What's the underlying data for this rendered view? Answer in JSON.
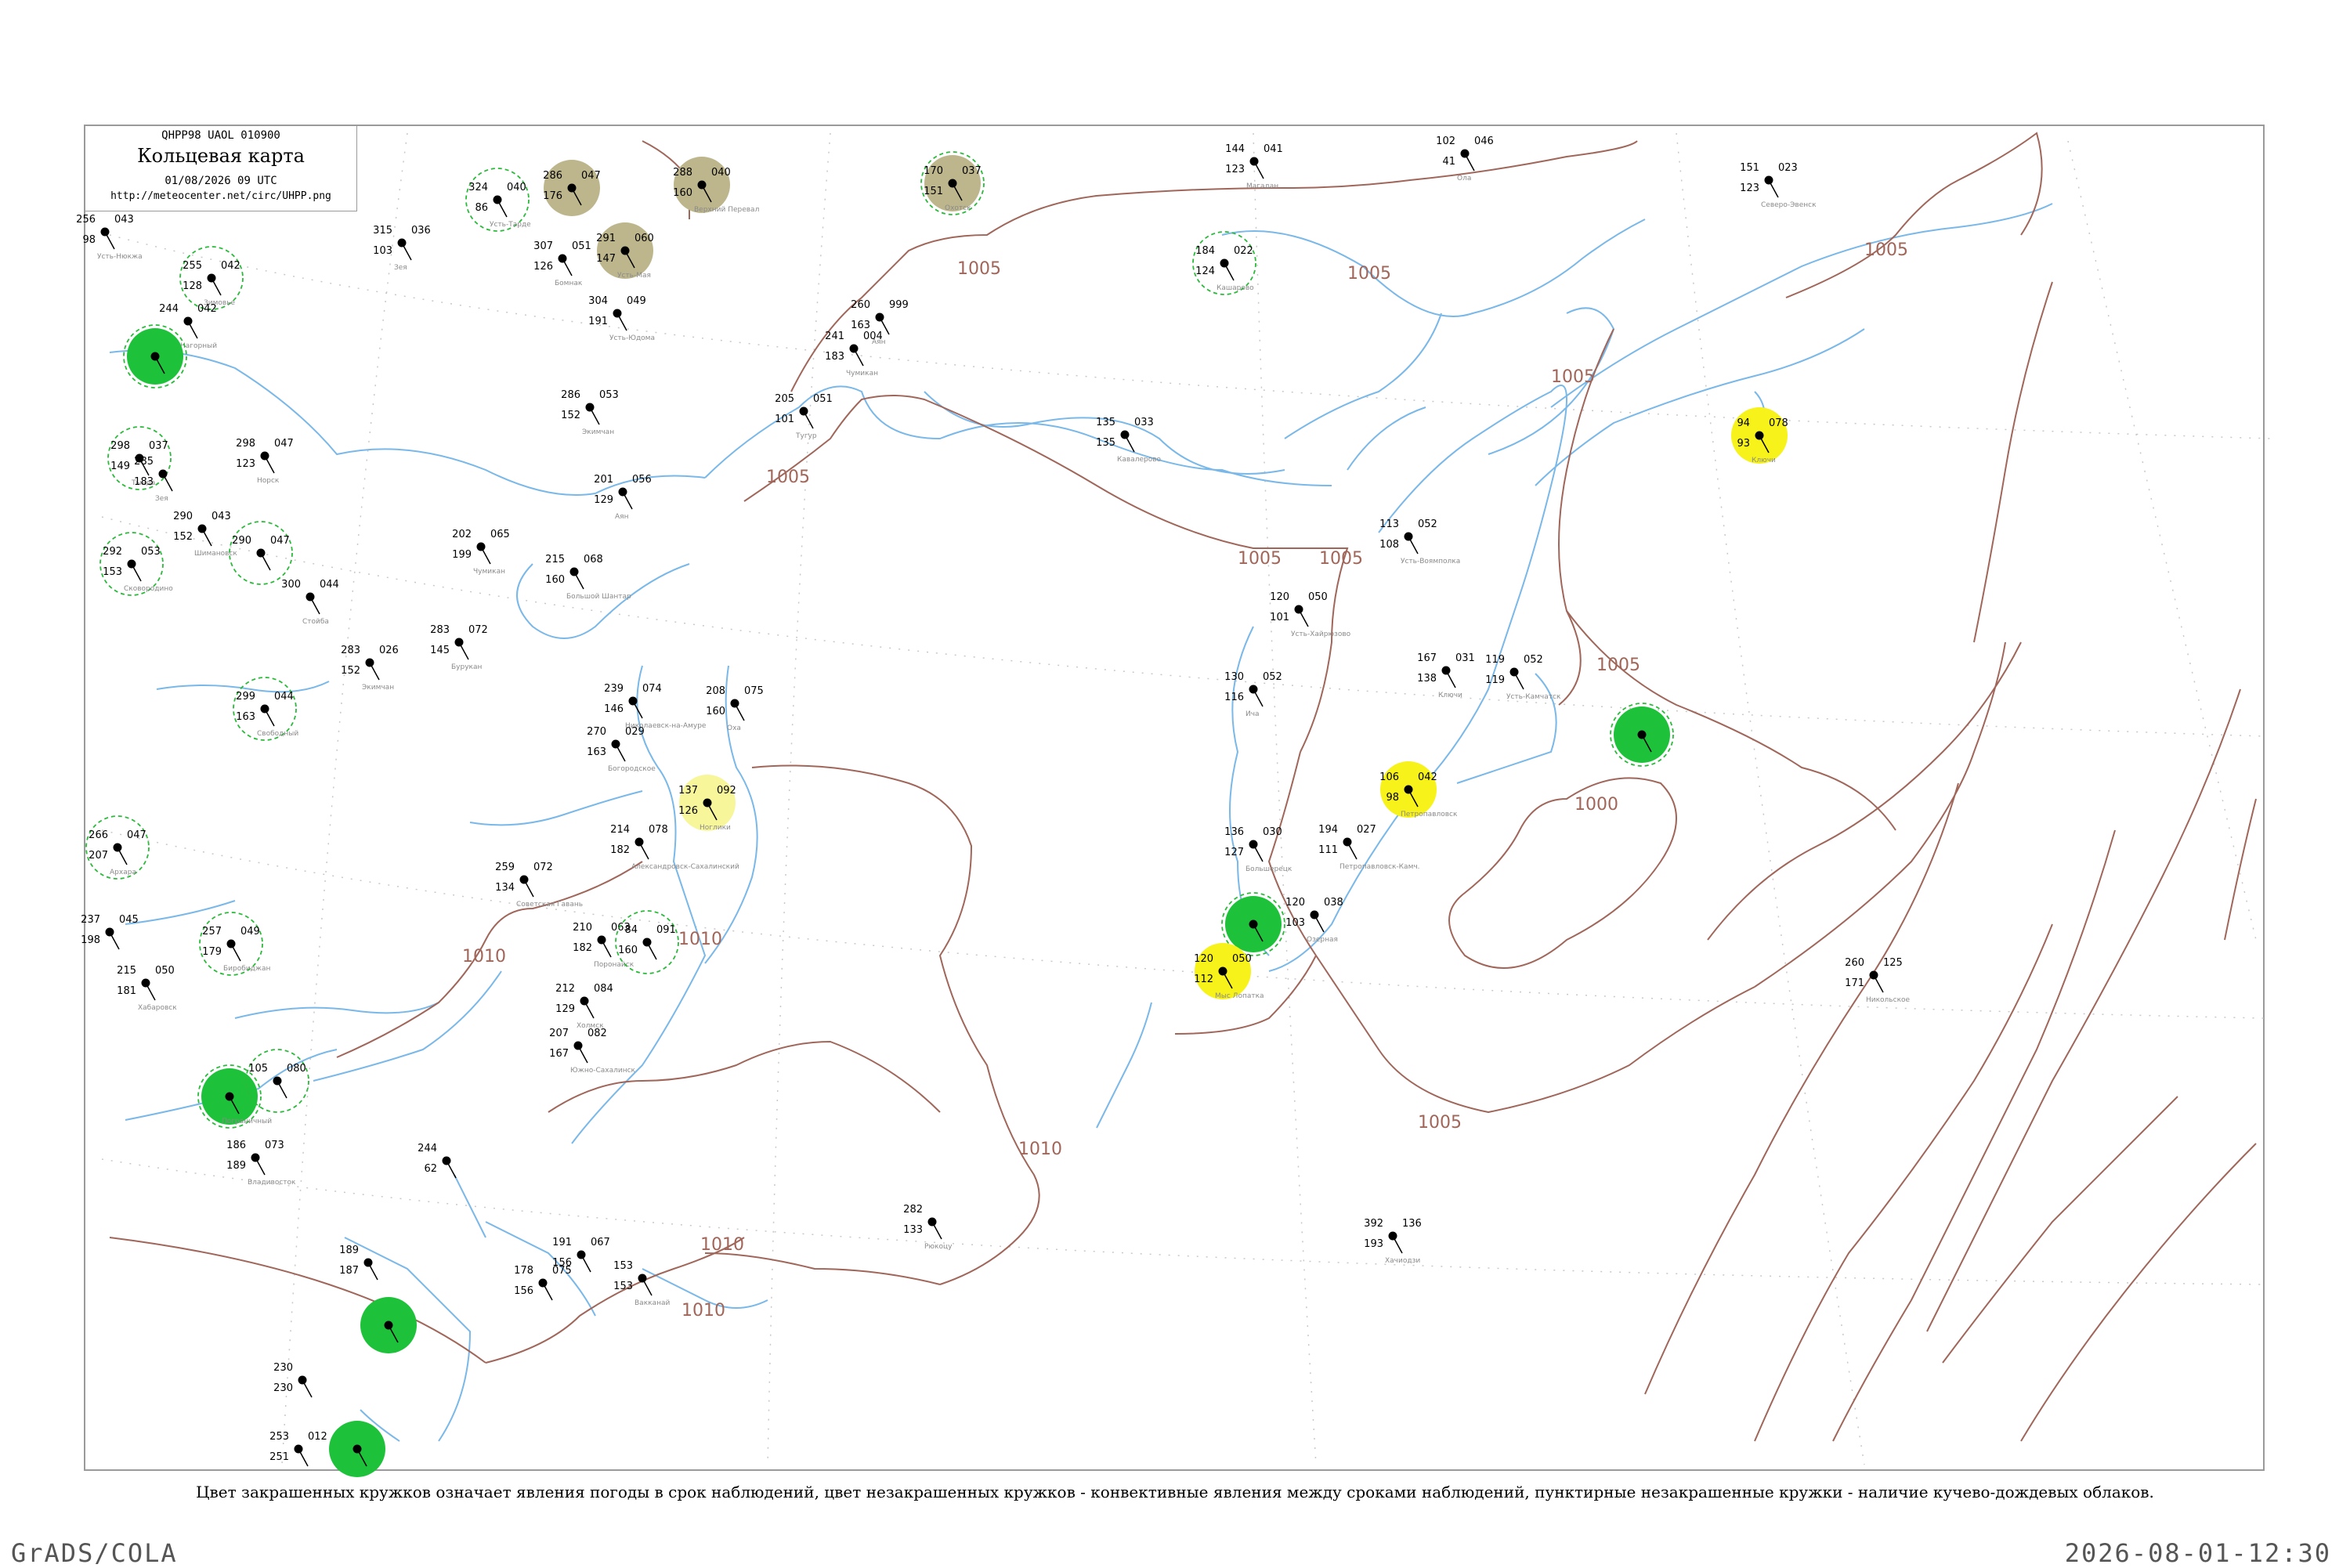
{
  "header": {
    "code": "QHPP98  UAOL  010900",
    "title": "Кольцевая карта",
    "datetime": "01/08/2026 09 UTC",
    "url": "http://meteocenter.net/circ/UHPP.png"
  },
  "caption": "Цвет закрашенных кружков означает явления погоды в срок наблюдений, цвет незакрашенных кружков - конвективные явления между сроками наблюдений, пунктирные незакрашенные кружки - наличие кучево-дождевых облаков.",
  "footer": {
    "left": "GrADS/COLA",
    "right": "2026-08-01-12:30"
  },
  "colors": {
    "coast": "#79b8e8",
    "isobar": "#a0665a",
    "green_fill": "#1ec23a",
    "yellow_fill": "#f6f21a",
    "light_yellow_fill": "#f8f69a",
    "olive_fill": "#bdb68c",
    "dashed_green": "#2aba3a"
  },
  "isobars": [
    {
      "label": "1005"
    },
    {
      "label": "1005"
    },
    {
      "label": "1005"
    },
    {
      "label": "1005"
    },
    {
      "label": "1005"
    },
    {
      "label": "1005"
    },
    {
      "label": "1005"
    },
    {
      "label": "1005"
    },
    {
      "label": "1005"
    },
    {
      "label": "1010"
    },
    {
      "label": "1010"
    },
    {
      "label": "1010"
    },
    {
      "label": "1010"
    },
    {
      "label": "1010"
    },
    {
      "label": "1000"
    }
  ],
  "stations": [
    {
      "t": "256",
      "m": "043",
      "b": "98",
      "name": "Усть-Нюкжа"
    },
    {
      "t": "255",
      "m": "042",
      "b": "128",
      "name": "Зимовье",
      "ring": "dashed"
    },
    {
      "t": "244",
      "m": "042",
      "b": "",
      "name": "Нагорный"
    },
    {
      "t": "",
      "m": "",
      "b": "",
      "name": "",
      "fill": "green",
      "ring": "dashed"
    },
    {
      "t": "324",
      "m": "040",
      "b": "86",
      "name": "Усть-Тарде",
      "ring": "dashed"
    },
    {
      "t": "286",
      "m": "047",
      "b": "176",
      "name": "",
      "fill": "olive"
    },
    {
      "t": "288",
      "m": "040",
      "b": "160",
      "name": "Верхний Перевал",
      "fill": "olive"
    },
    {
      "t": "170",
      "m": "037",
      "b": "151",
      "name": "Охотск",
      "fill": "olive",
      "ring": "dashed"
    },
    {
      "t": "315",
      "m": "036",
      "b": "103",
      "name": "Зея"
    },
    {
      "t": "307",
      "m": "051",
      "b": "126",
      "name": "Бомнак"
    },
    {
      "t": "291",
      "m": "060",
      "b": "147",
      "name": "Усть-Мая",
      "fill": "olive"
    },
    {
      "t": "184",
      "m": "022",
      "b": "124",
      "name": "Кашарово",
      "ring": "dashed"
    },
    {
      "t": "144",
      "m": "041",
      "b": "123",
      "name": "Магадан"
    },
    {
      "t": "102",
      "m": "046",
      "b": "41",
      "name": "Ола"
    },
    {
      "t": "151",
      "m": "023",
      "b": "123",
      "name": "Северо-Эвенск"
    },
    {
      "t": "304",
      "m": "049",
      "b": "191",
      "name": "Усть-Юдома"
    },
    {
      "t": "260",
      "m": "999",
      "b": "163",
      "name": "Аян"
    },
    {
      "t": "241",
      "m": "004",
      "b": "183",
      "name": "Чумикан"
    },
    {
      "t": "286",
      "m": "053",
      "b": "152",
      "name": "Экимчан"
    },
    {
      "t": "205",
      "m": "051",
      "b": "101",
      "name": "Тугур"
    },
    {
      "t": "135",
      "m": "033",
      "b": "135",
      "name": "Кавалерово"
    },
    {
      "t": "94",
      "m": "078",
      "b": "93",
      "name": "Ключи",
      "fill": "yellow"
    },
    {
      "t": "298",
      "m": "037",
      "b": "149",
      "name": "Тында",
      "ring": "dashed"
    },
    {
      "t": "298",
      "m": "047",
      "b": "123",
      "name": "Норск"
    },
    {
      "t": "285",
      "m": "",
      "b": "183",
      "name": "Зея"
    },
    {
      "t": "201",
      "m": "056",
      "b": "129",
      "name": "Аян"
    },
    {
      "t": "292",
      "m": "053",
      "b": "153",
      "name": "Сковородино",
      "ring": "dashed"
    },
    {
      "t": "290",
      "m": "043",
      "b": "152",
      "name": "Шимановск"
    },
    {
      "t": "290",
      "m": "047",
      "b": "",
      "name": "",
      "ring": "dashed"
    },
    {
      "t": "202",
      "m": "065",
      "b": "199",
      "name": "Чумикан"
    },
    {
      "t": "215",
      "m": "068",
      "b": "160",
      "name": "Большой Шантар"
    },
    {
      "t": "113",
      "m": "052",
      "b": "108",
      "name": "Усть-Воямполка"
    },
    {
      "t": "120",
      "m": "050",
      "b": "101",
      "name": "Усть-Хайрюзово"
    },
    {
      "t": "300",
      "m": "044",
      "b": "",
      "name": "Стойба"
    },
    {
      "t": "283",
      "m": "026",
      "b": "152",
      "name": "Экимчан"
    },
    {
      "t": "283",
      "m": "072",
      "b": "145",
      "name": "Бурукан"
    },
    {
      "t": "167",
      "m": "031",
      "b": "138",
      "name": "Ключи"
    },
    {
      "t": "119",
      "m": "052",
      "b": "119",
      "name": "Усть-Камчатск"
    },
    {
      "t": "130",
      "m": "052",
      "b": "116",
      "name": "Ича"
    },
    {
      "t": "299",
      "m": "044",
      "b": "163",
      "name": "Свободный",
      "ring": "dashed"
    },
    {
      "t": "239",
      "m": "074",
      "b": "146",
      "name": "Николаевск-на-Амуре"
    },
    {
      "t": "208",
      "m": "075",
      "b": "160",
      "name": "Оха"
    },
    {
      "t": "",
      "m": "",
      "b": "",
      "name": "",
      "fill": "green",
      "ring": "dashed"
    },
    {
      "t": "270",
      "m": "029",
      "b": "163",
      "name": "Богородское"
    },
    {
      "t": "266",
      "m": "047",
      "b": "207",
      "name": "Архара",
      "ring": "dashed"
    },
    {
      "t": "137",
      "m": "092",
      "b": "126",
      "name": "Ноглики",
      "fill": "lightyellow"
    },
    {
      "t": "106",
      "m": "042",
      "b": "98",
      "name": "Петропавловск",
      "fill": "yellow"
    },
    {
      "t": "136",
      "m": "030",
      "b": "127",
      "name": "Большерецк"
    },
    {
      "t": "194",
      "m": "027",
      "b": "111",
      "name": "Петропавловск-Камч."
    },
    {
      "t": "214",
      "m": "078",
      "b": "182",
      "name": "Александровск-Сахалинский"
    },
    {
      "t": "259",
      "m": "072",
      "b": "134",
      "name": "Советская Гавань"
    },
    {
      "t": "",
      "m": "",
      "b": "",
      "name": "",
      "fill": "green",
      "ring": "dashed"
    },
    {
      "t": "120",
      "m": "050",
      "b": "112",
      "name": "Мыс Лопатка",
      "fill": "yellow"
    },
    {
      "t": "120",
      "m": "038",
      "b": "103",
      "name": "Озерная"
    },
    {
      "t": "237",
      "m": "045",
      "b": "198",
      "name": ""
    },
    {
      "t": "257",
      "m": "049",
      "b": "179",
      "name": "Биробиджан",
      "ring": "dashed"
    },
    {
      "t": "215",
      "m": "050",
      "b": "181",
      "name": "Хабаровск"
    },
    {
      "t": "210",
      "m": "063",
      "b": "182",
      "name": "Поронайск"
    },
    {
      "t": "84",
      "m": "091",
      "b": "160",
      "name": "",
      "ring": "dashed"
    },
    {
      "t": "260",
      "m": "125",
      "b": "171",
      "name": "Никольское"
    },
    {
      "t": "",
      "m": "",
      "b": "",
      "name": "Пограничный",
      "fill": "green",
      "ring": "dashed"
    },
    {
      "t": "105",
      "m": "080",
      "b": "",
      "name": "",
      "ring": "dashed"
    },
    {
      "t": "212",
      "m": "084",
      "b": "129",
      "name": "Холмск"
    },
    {
      "t": "207",
      "m": "082",
      "b": "167",
      "name": "Южно-Сахалинск"
    },
    {
      "t": "186",
      "m": "073",
      "b": "189",
      "name": "Владивосток"
    },
    {
      "t": "244",
      "m": "",
      "b": "62",
      "name": ""
    },
    {
      "t": "282",
      "m": "",
      "b": "133",
      "name": "Рюкоцу"
    },
    {
      "t": "392",
      "m": "136",
      "b": "193",
      "name": "Хачиодзи"
    },
    {
      "t": "189",
      "m": "",
      "b": "187",
      "name": ""
    },
    {
      "t": "",
      "m": "",
      "b": "",
      "name": "",
      "fill": "green"
    },
    {
      "t": "230",
      "m": "",
      "b": "230",
      "name": ""
    },
    {
      "t": "253",
      "m": "012",
      "b": "251",
      "name": ""
    },
    {
      "t": "",
      "m": "",
      "b": "",
      "name": "",
      "fill": "green"
    },
    {
      "t": "153",
      "m": "",
      "b": "153",
      "name": "Вакканай"
    },
    {
      "t": "191",
      "m": "067",
      "b": "156",
      "name": ""
    },
    {
      "t": "178",
      "m": "075",
      "b": "156",
      "name": ""
    }
  ]
}
